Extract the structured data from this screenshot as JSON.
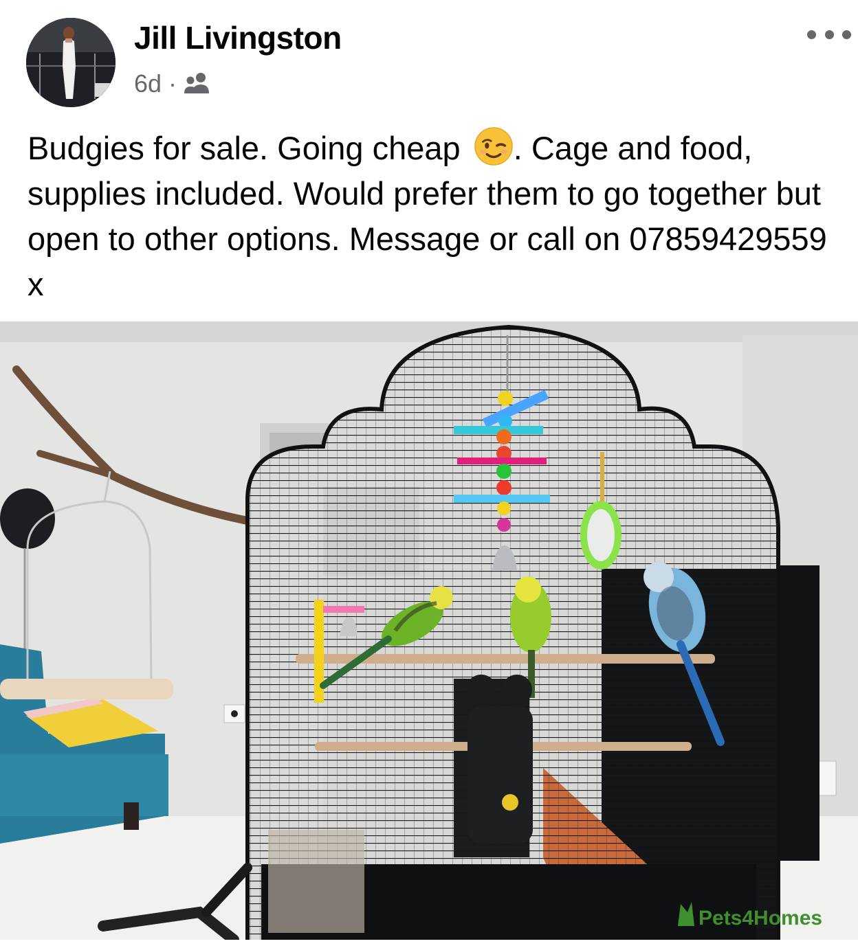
{
  "post": {
    "author": "Jill Livingston",
    "time": "6d",
    "separator": "·",
    "audience_icon": "friends-icon",
    "more_icon": "more-options-icon",
    "text_part1": "Budgies for sale. Going cheap ",
    "emoji": "winking-face-emoji",
    "text_part2": ". Cage and food, supplies included. Would prefer them to go together but open to other options. Message or call on 07859429559 x"
  },
  "photo": {
    "watermark": "Pets4Homes"
  },
  "colors": {
    "text": "#050505",
    "secondary": "#65676b",
    "watermark_green": "#3f8f2f"
  }
}
